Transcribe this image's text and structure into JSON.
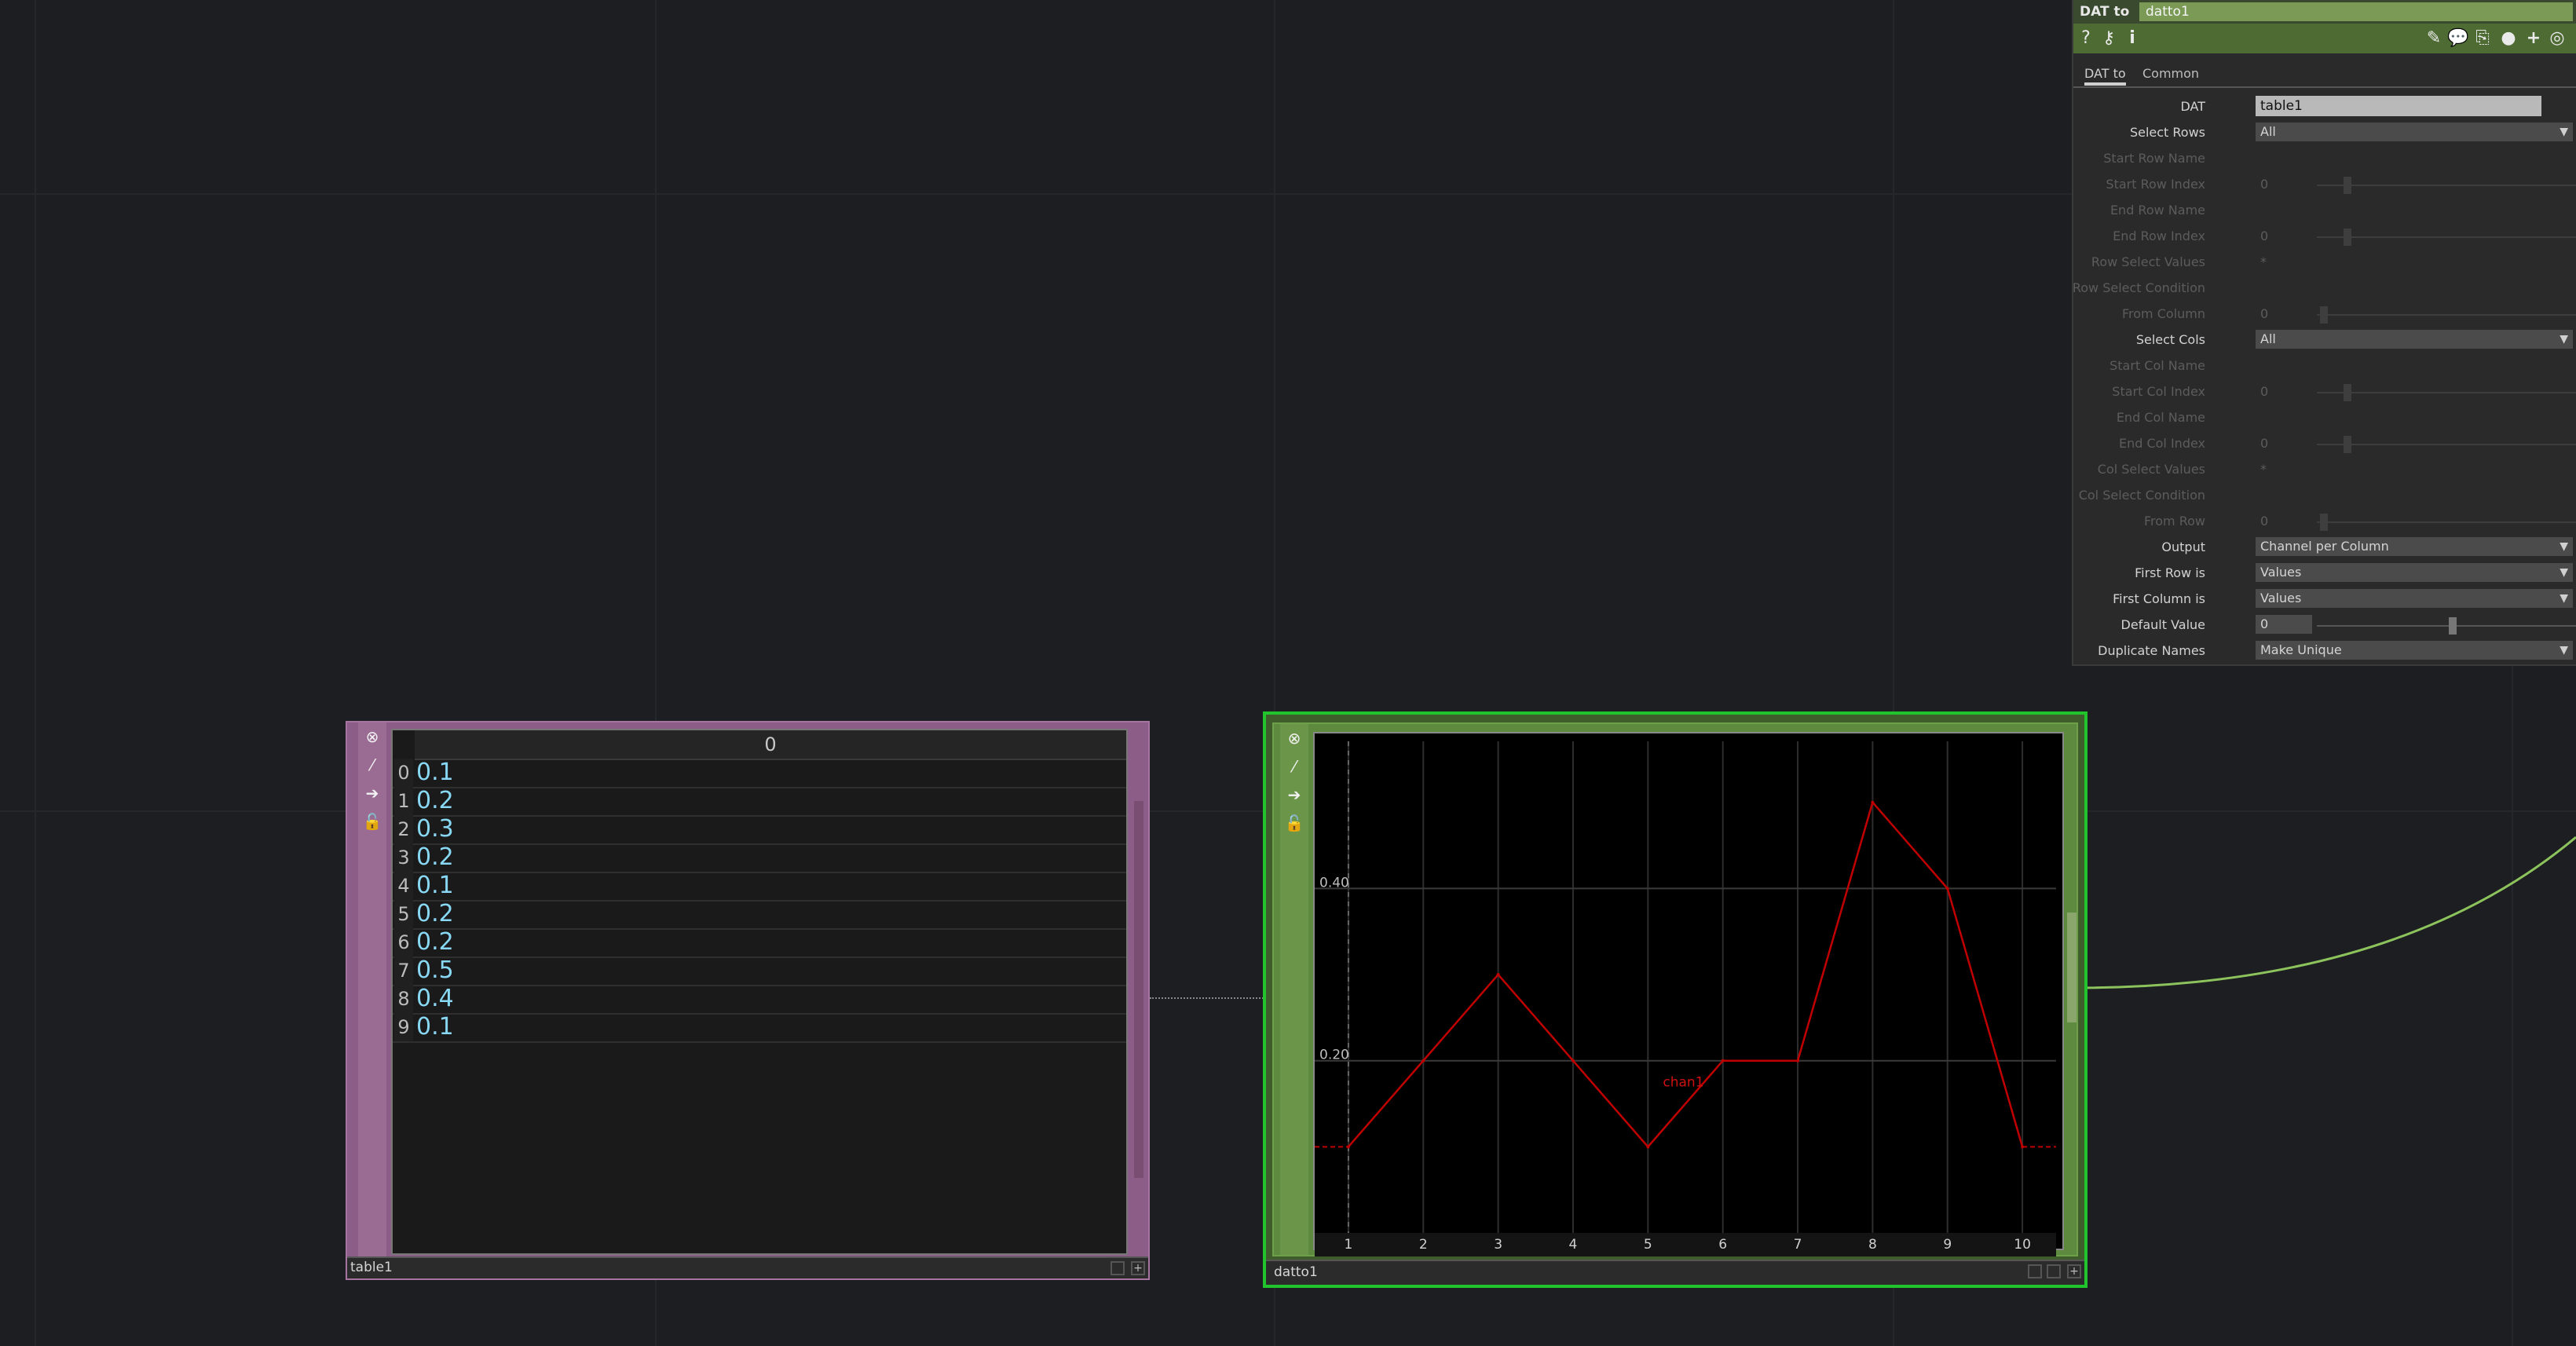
{
  "param_panel": {
    "op_type": "DAT to",
    "op_name": "datto1",
    "tabs": [
      {
        "label": "DAT to",
        "active": true
      },
      {
        "label": "Common",
        "active": false
      }
    ],
    "params": [
      {
        "label": "DAT",
        "kind": "field",
        "value": "table1",
        "enabled": true
      },
      {
        "label": "Select Rows",
        "kind": "menu",
        "value": "All",
        "enabled": true
      },
      {
        "label": "Start Row Name",
        "kind": "text",
        "value": "",
        "enabled": false
      },
      {
        "label": "Start Row Index",
        "kind": "slider",
        "value": "0",
        "enabled": false
      },
      {
        "label": "End Row  Name",
        "kind": "text",
        "value": "",
        "enabled": false
      },
      {
        "label": "End Row Index",
        "kind": "slider",
        "value": "0",
        "enabled": false
      },
      {
        "label": "Row Select Values",
        "kind": "text",
        "value": "*",
        "enabled": false
      },
      {
        "label": "Row Select Condition",
        "kind": "text",
        "value": "",
        "enabled": false
      },
      {
        "label": "From Column",
        "kind": "slider",
        "value": "0",
        "enabled": false
      },
      {
        "label": "Select Cols",
        "kind": "menu",
        "value": "All",
        "enabled": true
      },
      {
        "label": "Start Col Name",
        "kind": "text",
        "value": "",
        "enabled": false
      },
      {
        "label": "Start Col Index",
        "kind": "slider",
        "value": "0",
        "enabled": false
      },
      {
        "label": "End Col Name",
        "kind": "text",
        "value": "",
        "enabled": false
      },
      {
        "label": "End Col Index",
        "kind": "slider",
        "value": "0",
        "enabled": false
      },
      {
        "label": "Col Select Values",
        "kind": "text",
        "value": "*",
        "enabled": false
      },
      {
        "label": "Col Select Condition",
        "kind": "text",
        "value": "",
        "enabled": false
      },
      {
        "label": "From Row",
        "kind": "slider",
        "value": "0",
        "enabled": false
      },
      {
        "label": "Output",
        "kind": "menu",
        "value": "Channel per Column",
        "enabled": true
      },
      {
        "label": "First Row is",
        "kind": "menu",
        "value": "Values",
        "enabled": true
      },
      {
        "label": "First Column is",
        "kind": "menu",
        "value": "Values",
        "enabled": true
      },
      {
        "label": "Default Value",
        "kind": "slider",
        "value": "0",
        "enabled": true
      },
      {
        "label": "Duplicate Names",
        "kind": "menu",
        "value": "Make Unique",
        "enabled": true
      }
    ],
    "toolbar_icons": [
      "help-icon",
      "python-help-icon",
      "info-icon",
      "edit-icon",
      "comment-icon",
      "clone-icon",
      "python-icon",
      "add-icon",
      "viewer-icon"
    ]
  },
  "table_node": {
    "name": "table1",
    "header": "0",
    "rows": [
      {
        "index": "0",
        "value": "0.1"
      },
      {
        "index": "1",
        "value": "0.2"
      },
      {
        "index": "2",
        "value": "0.3"
      },
      {
        "index": "3",
        "value": "0.2"
      },
      {
        "index": "4",
        "value": "0.1"
      },
      {
        "index": "5",
        "value": "0.2"
      },
      {
        "index": "6",
        "value": "0.2"
      },
      {
        "index": "7",
        "value": "0.5"
      },
      {
        "index": "8",
        "value": "0.4"
      },
      {
        "index": "9",
        "value": "0.1"
      }
    ],
    "color": "#8c5d86"
  },
  "datto_node": {
    "name": "datto1",
    "selected_color": "#21c42c",
    "chart": {
      "type": "line",
      "series_label": "chan1",
      "x": [
        1,
        2,
        3,
        4,
        5,
        6,
        7,
        8,
        9,
        10
      ],
      "values": [
        0.1,
        0.2,
        0.3,
        0.2,
        0.1,
        0.2,
        0.2,
        0.5,
        0.4,
        0.1
      ],
      "x_tick_labels": [
        "1",
        "2",
        "3",
        "4",
        "5",
        "6",
        "7",
        "8",
        "9",
        "10"
      ],
      "y_tick_labels": [
        "0.40",
        "0.20"
      ],
      "y_ticks": [
        0.4,
        0.2
      ],
      "ylim": [
        0.0,
        0.58
      ],
      "xlim": [
        0.55,
        10.45
      ],
      "line_color": "#c00000",
      "grid": true
    }
  }
}
